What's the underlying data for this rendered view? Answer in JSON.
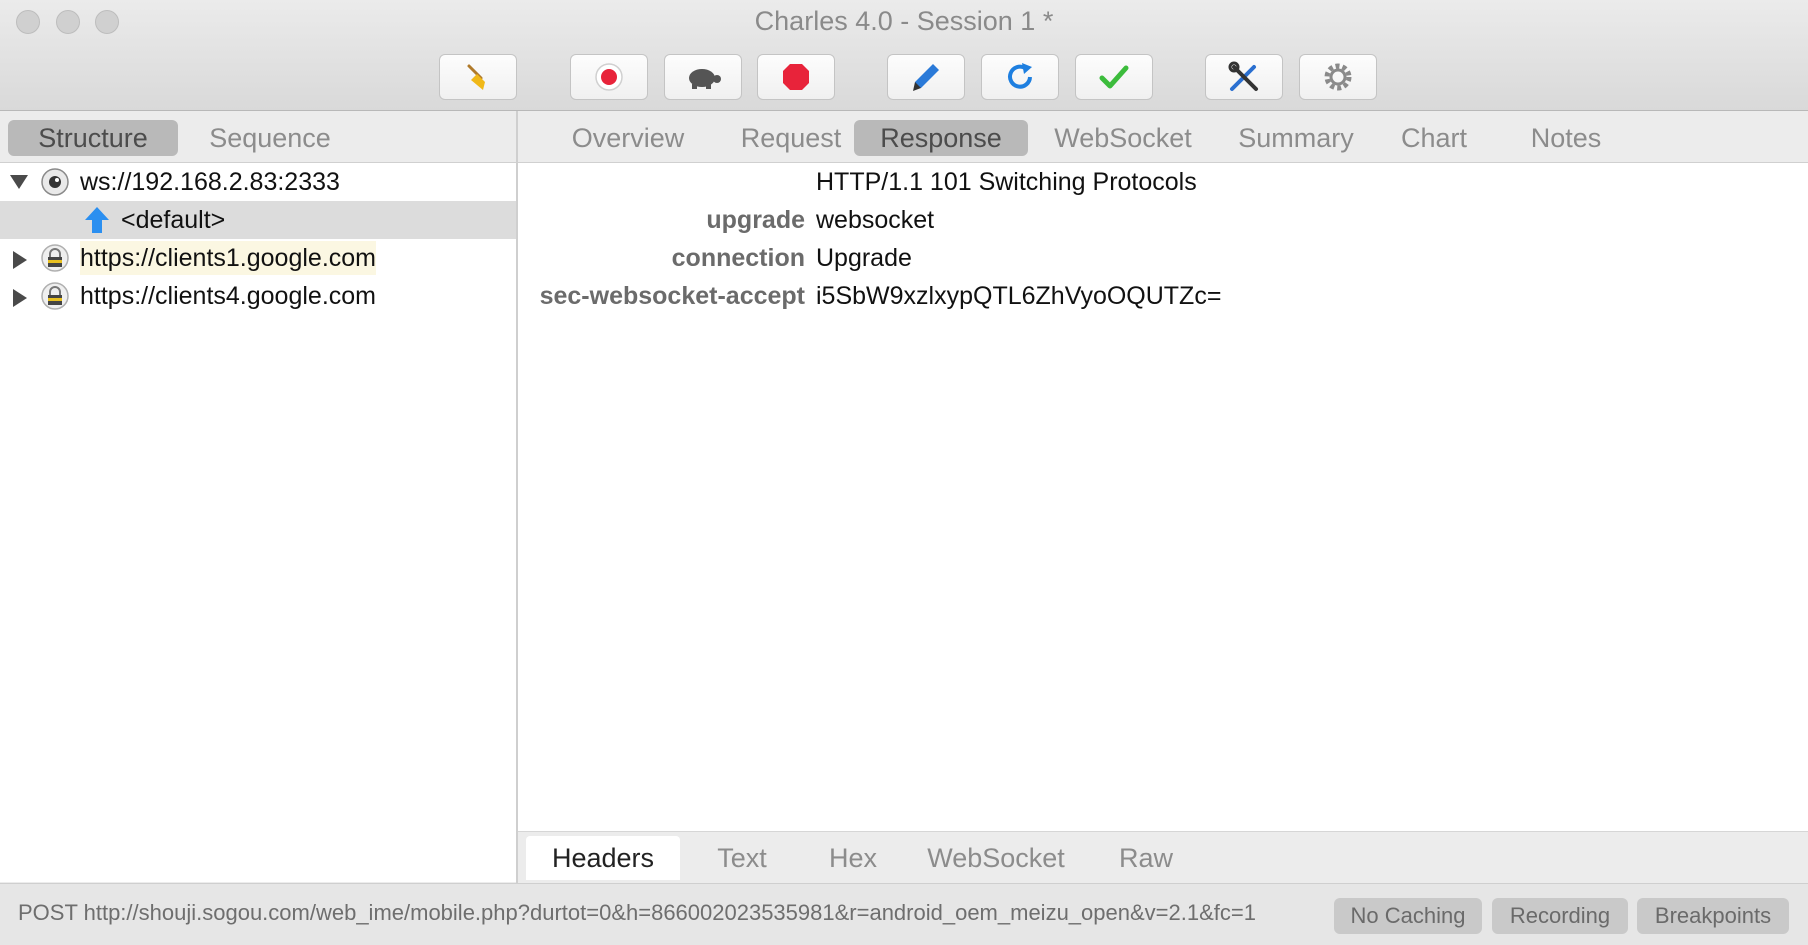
{
  "window": {
    "title": "Charles 4.0 - Session 1 *"
  },
  "toolbar": {
    "buttons": [
      {
        "icon": "broom-icon",
        "label": "Clear"
      },
      {
        "icon": "record-icon",
        "label": "Record"
      },
      {
        "icon": "turtle-icon",
        "label": "Throttle"
      },
      {
        "icon": "stop-icon",
        "label": "Breakpoints"
      },
      {
        "icon": "pen-icon",
        "label": "Compose"
      },
      {
        "icon": "refresh-icon",
        "label": "Repeat"
      },
      {
        "icon": "checkmark-icon",
        "label": "Validate"
      },
      {
        "icon": "tools-icon",
        "label": "Tools"
      },
      {
        "icon": "gear-icon",
        "label": "Settings"
      }
    ]
  },
  "left_tabs": {
    "structure": "Structure",
    "sequence": "Sequence",
    "active": "Structure"
  },
  "detail_tabs": {
    "items": [
      "Overview",
      "Request",
      "Response",
      "WebSocket",
      "Summary",
      "Chart",
      "Notes"
    ],
    "active": "Response"
  },
  "tree": {
    "rows": [
      {
        "label": "ws://192.168.2.83:2333",
        "icon": "websocket-host-icon",
        "expanded": true
      },
      {
        "label": "<default>",
        "icon": "upload-arrow-icon",
        "selected": true
      },
      {
        "label": "https://clients1.google.com",
        "icon": "lock-icon",
        "expanded": false
      },
      {
        "label": "https://clients4.google.com",
        "icon": "lock-icon",
        "expanded": false
      }
    ]
  },
  "response_headers": {
    "status_line": "HTTP/1.1 101 Switching Protocols",
    "rows": [
      {
        "key": "upgrade",
        "value": "websocket"
      },
      {
        "key": "connection",
        "value": "Upgrade"
      },
      {
        "key": "sec-websocket-accept",
        "value": "i5SbW9xzlxypQTL6ZhVyoOQUTZc="
      }
    ]
  },
  "bottom_tabs": {
    "items": [
      "Headers",
      "Text",
      "Hex",
      "WebSocket",
      "Raw"
    ],
    "active": "Headers"
  },
  "statusbar": {
    "text": "POST http://shouji.sogou.com/web_ime/mobile.php?durtot=0&h=866002023535981&r=android_oem_meizu_open&v=2.1&fc=1",
    "no_caching": "No Caching",
    "recording": "Recording",
    "breakpoints": "Breakpoints"
  },
  "colors": {
    "record": "#e8233a",
    "stop": "#e8233a",
    "refresh": "#1e7fe0",
    "check": "#3cbc3c",
    "tab_active_bg": "#b9b9b9"
  }
}
